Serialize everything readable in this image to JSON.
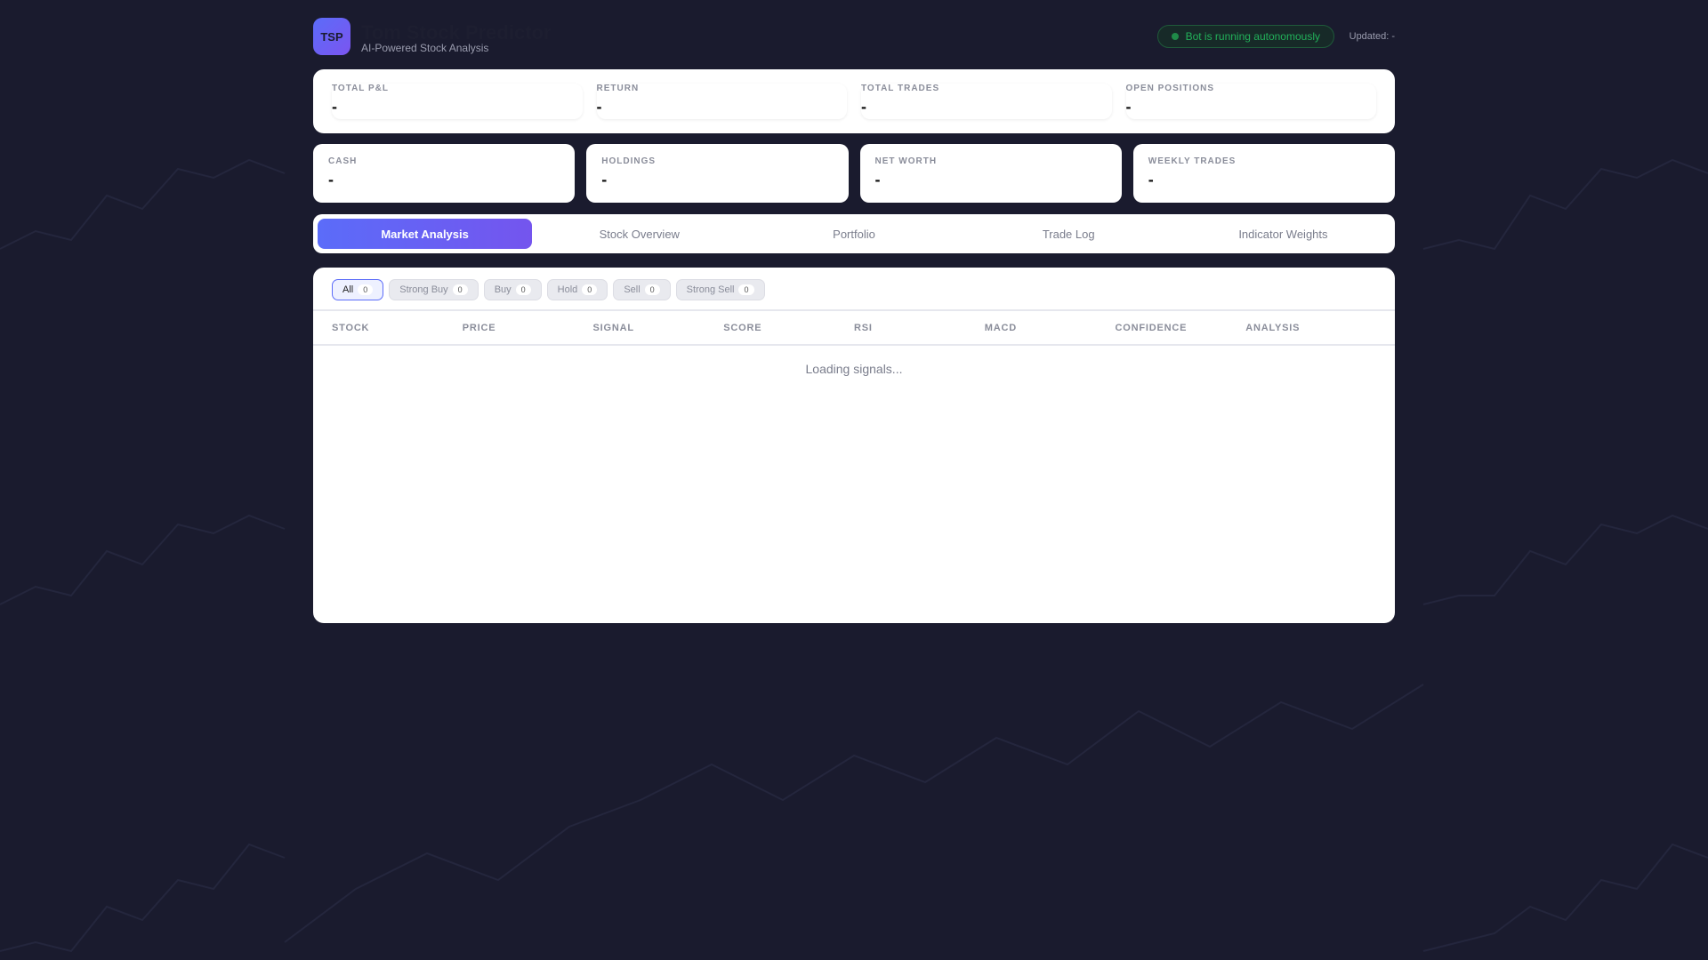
{
  "header": {
    "logo": "TSP",
    "title": "Tom Stock Predictor",
    "subtitle": "AI-Powered Stock Analysis",
    "status": "Bot is running autonomously",
    "updated": "Updated: -"
  },
  "stats_top": [
    {
      "label": "TOTAL P&L",
      "value": "-"
    },
    {
      "label": "RETURN",
      "value": "-"
    },
    {
      "label": "TOTAL TRADES",
      "value": "-"
    },
    {
      "label": "OPEN POSITIONS",
      "value": "-"
    }
  ],
  "stats_bottom": [
    {
      "label": "CASH",
      "value": "-"
    },
    {
      "label": "HOLDINGS",
      "value": "-"
    },
    {
      "label": "NET WORTH",
      "value": "-"
    },
    {
      "label": "WEEKLY TRADES",
      "value": "-"
    }
  ],
  "tabs": [
    "Market Analysis",
    "Stock Overview",
    "Portfolio",
    "Trade Log",
    "Indicator Weights"
  ],
  "filters": [
    {
      "label": "All",
      "count": "0"
    },
    {
      "label": "Strong Buy",
      "count": "0"
    },
    {
      "label": "Buy",
      "count": "0"
    },
    {
      "label": "Hold",
      "count": "0"
    },
    {
      "label": "Sell",
      "count": "0"
    },
    {
      "label": "Strong Sell",
      "count": "0"
    }
  ],
  "columns": [
    "STOCK",
    "PRICE",
    "SIGNAL",
    "SCORE",
    "RSI",
    "MACD",
    "CONFIDENCE",
    "ANALYSIS"
  ],
  "loading": "Loading signals...",
  "colors": {
    "accent": "#5b6cf9",
    "status": "#22b15a",
    "background": "#1a1b2e"
  }
}
